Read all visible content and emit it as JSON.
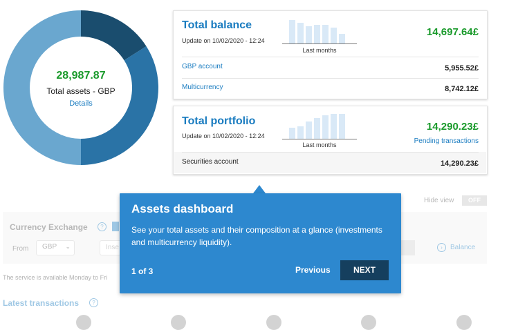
{
  "assets": {
    "total_value": "28,987.87",
    "label": "Total assets - GBP",
    "details_link": "Details",
    "segments": [
      {
        "color": "#1a4d6e",
        "fraction": 0.16
      },
      {
        "color": "#2a73a6",
        "fraction": 0.34
      },
      {
        "color": "#6aa7cf",
        "fraction": 0.5
      }
    ]
  },
  "balance_card": {
    "title": "Total balance",
    "update": "Update on 10/02/2020 - 12:24",
    "chart_caption": "Last months",
    "amount": "14,697.64£",
    "bars": [
      0.95,
      0.85,
      0.7,
      0.75,
      0.75,
      0.65,
      0.4
    ],
    "rows": [
      {
        "label": "GBP account",
        "value": "5,955.52£"
      },
      {
        "label": "Multicurrency",
        "value": "8,742.12£"
      }
    ]
  },
  "portfolio_card": {
    "title": "Total portfolio",
    "update": "Update on 10/02/2020 - 12:24",
    "chart_caption": "Last months",
    "amount": "14,290.23£",
    "pending": "Pending transactions",
    "bars": [
      0.45,
      0.5,
      0.7,
      0.85,
      0.95,
      1.0,
      1.0
    ],
    "rows": [
      {
        "label": "Securities account",
        "value": "14,290.23£"
      }
    ]
  },
  "background": {
    "hide_view": "Hide view",
    "toggle": "OFF",
    "currency_exchange": "Currency Exchange",
    "from_label": "From",
    "from_value": "GBP",
    "insert_placeholder": "Inse",
    "balance_link": "Balance",
    "service_note": "The service is available Monday to Fri",
    "latest_transactions": "Latest transactions"
  },
  "tooltip": {
    "title": "Assets dashboard",
    "body": "See your total assets and their composition at a glance (investments and multicurrency liquidity).",
    "step": "1 of 3",
    "previous": "Previous",
    "next": "NEXT"
  }
}
